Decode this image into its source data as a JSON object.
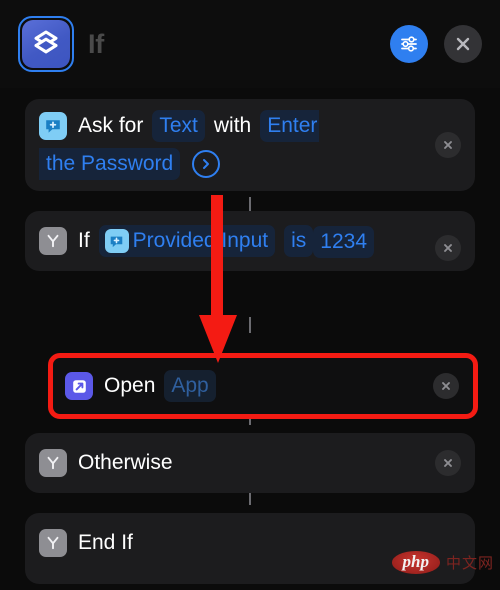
{
  "header": {
    "title": "If",
    "app_icon": "shortcuts-layers-icon",
    "settings_button": {
      "icon": "sliders-icon",
      "color": "#2f7ff0"
    },
    "close_button": {
      "icon": "close-x-icon",
      "color": "#333336"
    }
  },
  "colors": {
    "background": "#0b0b0b",
    "card": "#1c1c1e",
    "accent_blue": "#2f7ff0",
    "token_blue": "#2f7ff0",
    "token_bg": "#16243a",
    "highlight_red": "#f41b13",
    "text": "#ffffff"
  },
  "annotation": {
    "arrow": "red-down-arrow",
    "color": "#f41b13",
    "points_to": "Open App"
  },
  "actions": [
    {
      "name": "ask-for-input",
      "icon": "speech-bubble-plus-icon",
      "icon_color": "#7fcdf5",
      "segments": [
        {
          "type": "text",
          "value": "Ask for"
        },
        {
          "type": "token",
          "value": "Text"
        },
        {
          "type": "text",
          "value": "with"
        },
        {
          "type": "token",
          "value": "Enter"
        },
        {
          "type": "token",
          "value": "the Password"
        }
      ],
      "has_chevron": true,
      "chevron_icon": "chevron-right-circle-icon",
      "delete_icon": "close-x-icon"
    },
    {
      "name": "if-condition",
      "icon": "branch-y-icon",
      "icon_color": "#8e8e93",
      "segments": [
        {
          "type": "text",
          "value": "If"
        },
        {
          "type": "token_with_icon",
          "value": "Provided Input",
          "icon": "speech-bubble-plus-icon"
        },
        {
          "type": "token",
          "value": "is"
        },
        {
          "type": "token",
          "value": "1234"
        }
      ],
      "has_chevron": false,
      "delete_icon": "close-x-icon"
    },
    {
      "name": "open-app",
      "icon": "open-app-arrow-icon",
      "icon_color": "#5b58e8",
      "highlighted": true,
      "segments": [
        {
          "type": "text",
          "value": "Open"
        },
        {
          "type": "token_dim",
          "value": "App"
        }
      ],
      "has_chevron": false,
      "delete_icon": "close-x-icon"
    },
    {
      "name": "otherwise",
      "icon": "branch-y-icon",
      "icon_color": "#8e8e93",
      "segments": [
        {
          "type": "text",
          "value": "Otherwise"
        }
      ],
      "has_chevron": false,
      "delete_icon": "close-x-icon"
    },
    {
      "name": "end-if",
      "icon": "branch-y-icon",
      "icon_color": "#8e8e93",
      "segments": [
        {
          "type": "text",
          "value": "End If"
        }
      ],
      "has_chevron": false,
      "delete_icon": "close-x-icon"
    }
  ],
  "watermark": {
    "logo": "php",
    "text": "中文网"
  }
}
